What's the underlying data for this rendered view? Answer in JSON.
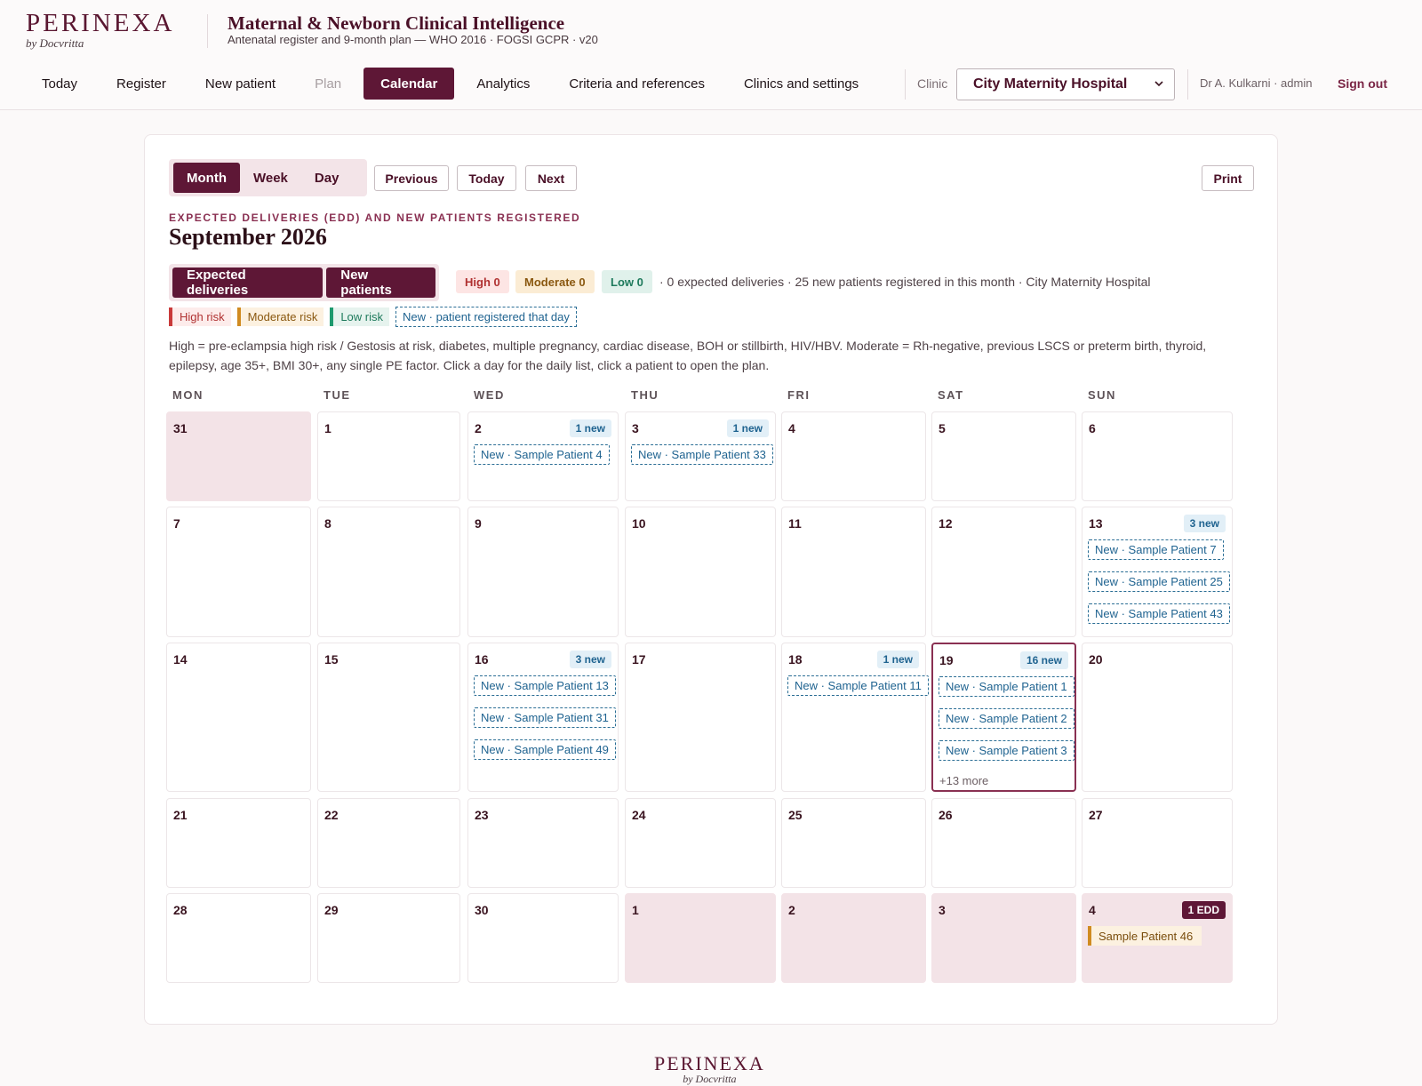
{
  "brand": {
    "name": "PERINEXA",
    "sub": "by Docvritta"
  },
  "app": {
    "title": "Maternal & Newborn Clinical Intelligence",
    "subtitle": "Antenatal register and 9-month plan — WHO 2016 · FOGSI GCPR · v20"
  },
  "nav": [
    "Today",
    "Register",
    "New patient",
    "Plan",
    "Calendar",
    "Analytics",
    "Criteria and references",
    "Clinics and settings"
  ],
  "nav_active": "Calendar",
  "nav_disabled": "Plan",
  "clinic": {
    "label": "Clinic",
    "value": "City Maternity Hospital"
  },
  "user": "Dr A. Kulkarni · admin",
  "signout": "Sign out",
  "view_modes": [
    "Month",
    "Week",
    "Day"
  ],
  "view_active": "Month",
  "toolbar": {
    "previous": "Previous",
    "today": "Today",
    "next": "Next",
    "print": "Print"
  },
  "eyebrow": "EXPECTED DELIVERIES (EDD) AND NEW PATIENTS REGISTERED",
  "month_title": "September 2026",
  "layers": [
    "Expected deliveries",
    "New patients"
  ],
  "counts": {
    "high": "High 0",
    "moderate": "Moderate 0",
    "low": "Low 0"
  },
  "summary": "· 0 expected deliveries · 25 new patients registered in this month · City Maternity Hospital",
  "legend": {
    "high": "High risk",
    "moderate": "Moderate risk",
    "low": "Low risk",
    "new": "New · patient registered that day"
  },
  "explanation": "High = pre-eclampsia high risk / Gestosis at risk, diabetes, multiple pregnancy, cardiac disease, BOH or stillbirth, HIV/HBV. Moderate = Rh-negative, previous LSCS or preterm birth, thyroid, epilepsy, age 35+, BMI 30+, any single PE factor. Click a day for the daily list, click a patient to open the plan.",
  "weekdays": [
    "MON",
    "TUE",
    "WED",
    "THU",
    "FRI",
    "SAT",
    "SUN"
  ],
  "weeks": [
    [
      {
        "day": "31",
        "out": true
      },
      {
        "day": "1"
      },
      {
        "day": "2",
        "badge": "1 new",
        "chips": [
          "New · Sample Patient 4"
        ]
      },
      {
        "day": "3",
        "badge": "1 new",
        "chips": [
          "New · Sample Patient 33"
        ]
      },
      {
        "day": "4"
      },
      {
        "day": "5"
      },
      {
        "day": "6"
      }
    ],
    [
      {
        "day": "7"
      },
      {
        "day": "8"
      },
      {
        "day": "9"
      },
      {
        "day": "10"
      },
      {
        "day": "11"
      },
      {
        "day": "12"
      },
      {
        "day": "13",
        "badge": "3 new",
        "chips": [
          "New · Sample Patient 7",
          "New · Sample Patient 25",
          "New · Sample Patient 43"
        ]
      }
    ],
    [
      {
        "day": "14"
      },
      {
        "day": "15"
      },
      {
        "day": "16",
        "badge": "3 new",
        "chips": [
          "New · Sample Patient 13",
          "New · Sample Patient 31",
          "New · Sample Patient 49"
        ]
      },
      {
        "day": "17"
      },
      {
        "day": "18",
        "badge": "1 new",
        "chips": [
          "New · Sample Patient 11"
        ]
      },
      {
        "day": "19",
        "badge": "16 new",
        "today": true,
        "chips": [
          "New · Sample Patient 1",
          "New · Sample Patient 2",
          "New · Sample Patient 3"
        ],
        "more": "+13 more"
      },
      {
        "day": "20"
      }
    ],
    [
      {
        "day": "21"
      },
      {
        "day": "22"
      },
      {
        "day": "23"
      },
      {
        "day": "24"
      },
      {
        "day": "25"
      },
      {
        "day": "26"
      },
      {
        "day": "27"
      }
    ],
    [
      {
        "day": "28"
      },
      {
        "day": "29"
      },
      {
        "day": "30"
      },
      {
        "day": "1",
        "out": true
      },
      {
        "day": "2",
        "out": true
      },
      {
        "day": "3",
        "out": true
      },
      {
        "day": "4",
        "out": true,
        "badge": "1 EDD",
        "badge_kind": "edd",
        "edd": [
          "Sample Patient 46"
        ]
      }
    ]
  ],
  "colors": {
    "brand": "#5e1736",
    "high": "#c93a3a",
    "moderate": "#d08b21",
    "low": "#1e9a6e",
    "new": "#1f6390",
    "out_of_month": "#f3e3e7"
  }
}
